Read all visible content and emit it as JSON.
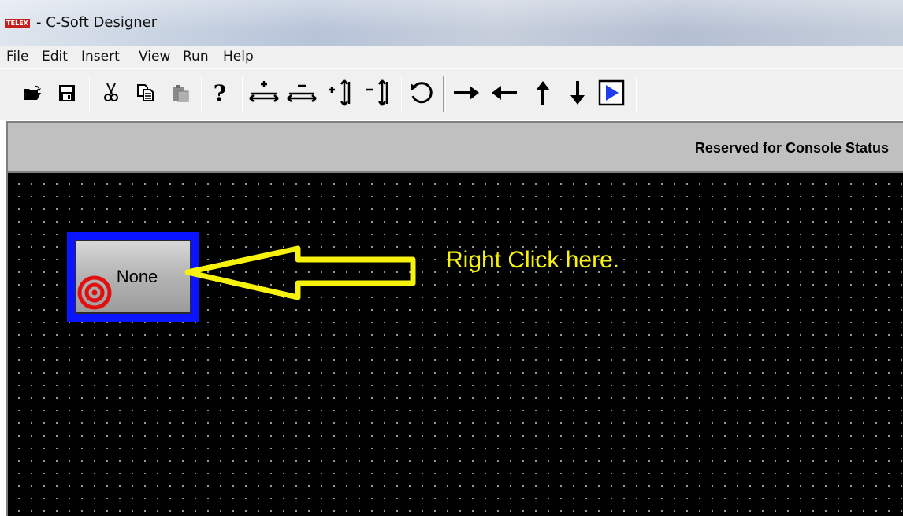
{
  "window": {
    "logo_text": "TELEX",
    "title": "- C-Soft Designer"
  },
  "menu": {
    "items": [
      {
        "label": "File"
      },
      {
        "label": "Edit"
      },
      {
        "label": "Insert"
      },
      {
        "label": "View"
      },
      {
        "label": "Run"
      },
      {
        "label": "Help"
      }
    ]
  },
  "toolbar": {
    "buttons": [
      {
        "icon": "open-folder-icon"
      },
      {
        "icon": "save-icon"
      },
      {
        "icon": "cut-icon"
      },
      {
        "icon": "copy-icon"
      },
      {
        "icon": "paste-icon"
      },
      {
        "icon": "help-icon"
      },
      {
        "icon": "increase-width-icon"
      },
      {
        "icon": "decrease-width-icon"
      },
      {
        "icon": "increase-height-icon"
      },
      {
        "icon": "decrease-height-icon"
      },
      {
        "icon": "undo-icon"
      },
      {
        "icon": "arrow-right-icon"
      },
      {
        "icon": "arrow-left-icon"
      },
      {
        "icon": "arrow-up-icon"
      },
      {
        "icon": "arrow-down-icon"
      },
      {
        "icon": "run-icon"
      }
    ]
  },
  "status": {
    "text": "Reserved for Console Status"
  },
  "canvas": {
    "button_label": "None",
    "instruction": "Right Click here."
  },
  "colors": {
    "selection_border": "#0a14ff",
    "annotation": "#f7f20b",
    "target": "#e01010",
    "canvas_background": "#000000"
  }
}
